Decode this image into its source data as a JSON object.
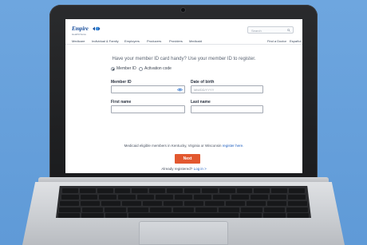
{
  "brand": {
    "name": "Empire",
    "tagline": "HealthChoice",
    "accent": "#1b4f9c"
  },
  "search": {
    "placeholder": "Search"
  },
  "nav": {
    "items": [
      "Medicare",
      "Individual & Family",
      "Employers",
      "Producers",
      "Providers",
      "Medicaid"
    ],
    "right_items": [
      "Find a Doctor",
      "Español"
    ]
  },
  "form": {
    "prompt": "Have your member ID card handy? Use your member ID to register.",
    "radio_member_id": "Member ID",
    "radio_activation_code": "Activation code",
    "member_id_label": "Member ID",
    "member_id_value": "",
    "dob_label": "Date of birth",
    "dob_placeholder": "MM/DD/YYYY",
    "first_name_label": "First name",
    "first_name_value": "",
    "last_name_label": "Last name",
    "last_name_value": ""
  },
  "medicaid": {
    "text": "Medicaid eligible members in Kentucky, Virginia or Wisconsin",
    "link": "register here."
  },
  "next_button": {
    "label": "Next",
    "color": "#e2582f"
  },
  "login": {
    "text": "Already registered?",
    "link": "Log in >"
  }
}
